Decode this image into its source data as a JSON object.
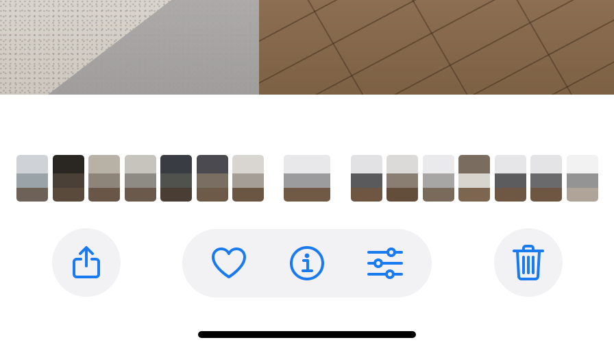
{
  "colors": {
    "accent": "#1a7af0",
    "button_bg": "#f2f2f4",
    "home_indicator": "#000000"
  },
  "photo": {
    "kind": "photo-of-floor-and-counter"
  },
  "thumbnails": [
    {
      "palette": [
        "#cfd3d8",
        "#9aa3a8",
        "#6e6258"
      ]
    },
    {
      "palette": [
        "#2a2622",
        "#4a4038",
        "#5a4a3c"
      ]
    },
    {
      "palette": [
        "#b8b2a6",
        "#8d847a",
        "#6a5646"
      ]
    },
    {
      "palette": [
        "#c7c3bd",
        "#8e8a84",
        "#6b5a4b"
      ]
    },
    {
      "palette": [
        "#3a3c44",
        "#50524e",
        "#4a3e34"
      ]
    },
    {
      "palette": [
        "#4a4a50",
        "#7a6e62",
        "#6e5a48"
      ]
    },
    {
      "palette": [
        "#d9d6d2",
        "#a59e96",
        "#6b5644"
      ]
    },
    {
      "palette": [
        "#e8e8ea",
        "#9c9c9e",
        "#715a45"
      ],
      "current": true
    },
    {
      "palette": [
        "#e2e2e4",
        "#5a5a5c",
        "#6e5642"
      ]
    },
    {
      "palette": [
        "#dcdad8",
        "#8a7e72",
        "#634e3c"
      ]
    },
    {
      "palette": [
        "#eaeaec",
        "#a8a6a4",
        "#7a6a5c"
      ]
    },
    {
      "palette": [
        "#7a6c5e",
        "#d8d4ce",
        "#7c6650"
      ]
    },
    {
      "palette": [
        "#e6e6e8",
        "#5c5c5e",
        "#6e5844"
      ]
    },
    {
      "palette": [
        "#e4e4e6",
        "#6a6a6c",
        "#6d5642"
      ]
    },
    {
      "palette": [
        "#e8e8ea",
        "#3e3e40",
        "#705a46"
      ]
    }
  ],
  "actions": {
    "share": {
      "icon": "share-icon"
    },
    "favorite": {
      "icon": "heart-icon"
    },
    "info": {
      "icon": "info-icon"
    },
    "adjust": {
      "icon": "sliders-icon"
    },
    "delete": {
      "icon": "trash-icon"
    }
  }
}
